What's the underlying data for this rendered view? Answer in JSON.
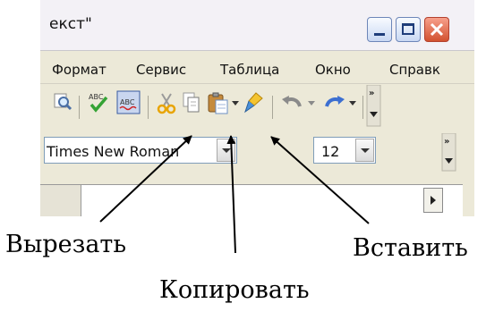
{
  "window": {
    "title": "екст\""
  },
  "menu": [
    {
      "label": "Формат"
    },
    {
      "label": "Сервис"
    },
    {
      "label": "Таблица"
    },
    {
      "label": "Окно"
    },
    {
      "label": "Справк"
    }
  ],
  "toolbar": {
    "icons": [
      "print-preview-icon",
      "spelling-icon",
      "auto-spellcheck-icon",
      "cut-icon",
      "copy-icon",
      "paste-icon",
      "format-paintbrush-icon",
      "undo-icon",
      "redo-icon",
      "toolbar-overflow-icon"
    ]
  },
  "format_toolbar": {
    "font_name": "Times New Roman",
    "font_size": "12"
  },
  "callouts": {
    "cut": "Вырезать",
    "copy": "Копировать",
    "paste": "Вставить"
  }
}
